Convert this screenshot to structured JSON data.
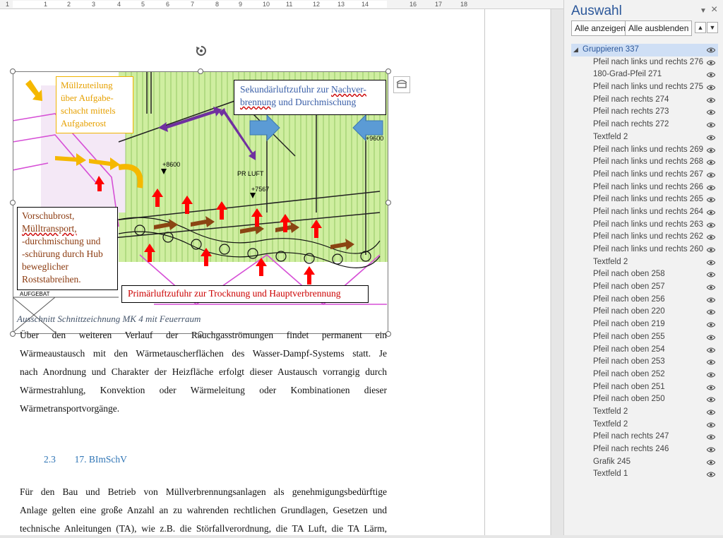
{
  "ruler": {
    "numbers": [
      "1",
      "1",
      "2",
      "3",
      "4",
      "5",
      "6",
      "7",
      "8",
      "9",
      "10",
      "11",
      "12",
      "13",
      "14",
      "16",
      "17",
      "18"
    ]
  },
  "figure": {
    "callouts": {
      "mullzuteilung": [
        "Müllzuteilung",
        "über Aufgabe-",
        "schacht mittels",
        "Aufgaberost"
      ],
      "sekundar_line1_a": "Sekundärluftzufuhr zur ",
      "sekundar_line1_b": "Nachver-",
      "sekundar_line2_a": "brennung",
      "sekundar_line2_b": " und Durchmischung",
      "vorschubrost": [
        "Vorschubrost,",
        "Mülltransport,",
        "-durchmischung und",
        "-schürung durch Hub",
        "beweglicher",
        "Roststabreihen."
      ],
      "primar": "Primärluftzufuhr zur Trocknung und Hauptverbrennung"
    },
    "drawing_labels": {
      "level1": "+8600",
      "level2": "+7567",
      "level3": "+9600",
      "pr_luft": "PR LUFT",
      "aufgabe": "AUFGEBAT"
    }
  },
  "caption": "Ausschnitt Schnittzeichnung MK 4 mit Feuerraum",
  "paragraph1": [
    "Über den weiteren Verlauf der Rauchgasströmungen findet permanent ein",
    "Wärmeaustausch mit den Wärmetauscherflächen des Wasser-Dampf-Systems statt. Je",
    "nach Anordnung und Charakter der Heizfläche erfolgt dieser Austausch vorrangig durch",
    "Wärmestrahlung, Konvektion oder Wärmeleitung oder Kombinationen dieser",
    "Wärmetransportvorgänge."
  ],
  "heading": {
    "number": "2.3",
    "title": "17. BImSchV"
  },
  "paragraph2": [
    "Für den Bau und Betrieb von Müllverbrennungsanlagen als genehmigungsbedürftige",
    "Anlage gelten eine große Anzahl an zu wahrenden rechtlichen Grundlagen, Gesetzen und",
    "technische Anleitungen (TA), wie z.B. die Störfallverordnung, die TA Luft, die TA Lärm,"
  ],
  "pane": {
    "title": "Auswahl",
    "show_all": "Alle anzeigen",
    "hide_all": "Alle ausblenden",
    "group": "Gruppieren 337",
    "items": [
      "Pfeil nach links und rechts 276",
      "180-Grad-Pfeil 271",
      "Pfeil nach links und rechts 275",
      "Pfeil nach rechts 274",
      "Pfeil nach rechts 273",
      "Pfeil nach rechts 272",
      "Textfeld 2",
      "Pfeil nach links und rechts 269",
      "Pfeil nach links und rechts 268",
      "Pfeil nach links und rechts 267",
      "Pfeil nach links und rechts 266",
      "Pfeil nach links und rechts 265",
      "Pfeil nach links und rechts 264",
      "Pfeil nach links und rechts 263",
      "Pfeil nach links und rechts 262",
      "Pfeil nach links und rechts 260",
      "Textfeld 2",
      "Pfeil nach oben 258",
      "Pfeil nach oben 257",
      "Pfeil nach oben 256",
      "Pfeil nach oben 220",
      "Pfeil nach oben 219",
      "Pfeil nach oben 255",
      "Pfeil nach oben 254",
      "Pfeil nach oben 253",
      "Pfeil nach oben 252",
      "Pfeil nach oben 251",
      "Pfeil nach oben 250",
      "Textfeld 2",
      "Textfeld 2",
      "Pfeil nach rechts 247",
      "Pfeil nach rechts 246",
      "Grafik 245",
      "Textfeld 1"
    ]
  },
  "colors": {
    "accent": "#2b579a",
    "heading": "#2e74b5",
    "selected_row": "#cfdff5"
  }
}
